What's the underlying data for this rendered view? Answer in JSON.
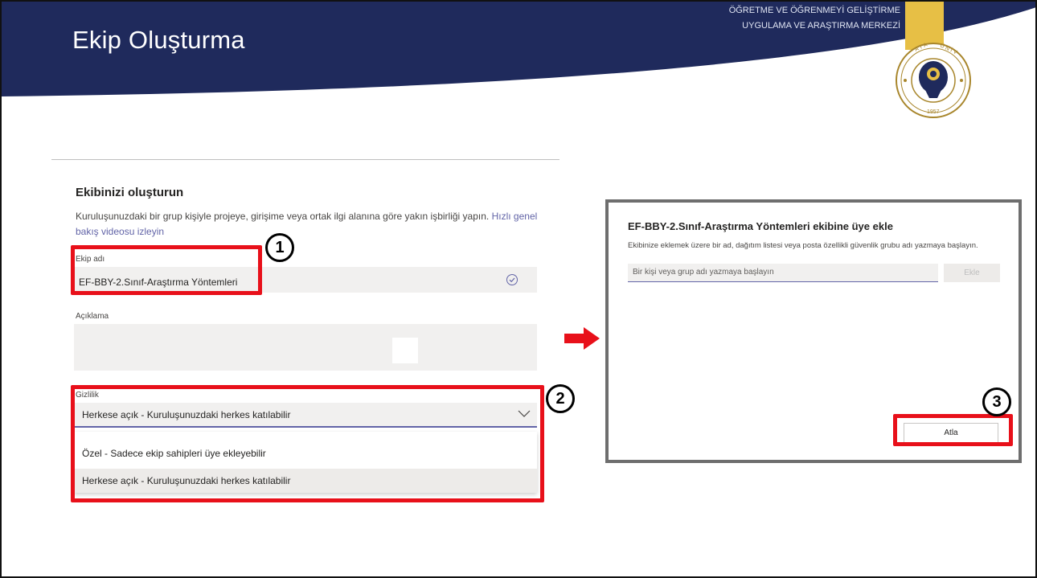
{
  "header": {
    "title": "Ekip Oluşturma",
    "center_line1": "ÖĞRETME VE ÖĞRENMEYİ GELİŞTİRME",
    "center_line2": "UYGULAMA VE ARAŞTIRMA MERKEZİ",
    "logo_icon": "university-seal-icon",
    "colors": {
      "header_bg": "#1f2a5c",
      "ribbon": "#e7bf45"
    }
  },
  "create_team_form": {
    "heading": "Ekibinizi oluşturun",
    "description": "Kuruluşunuzdaki bir grup kişiyle projeye, girişime veya ortak ilgi alanına göre yakın işbirliği yapın.",
    "video_link": "Hızlı genel bakış videosu izleyin",
    "team_name_label": "Ekip adı",
    "team_name_value": "EF-BBY-2.Sınıf-Araştırma Yöntemleri",
    "description_label": "Açıklama",
    "privacy_label": "Gizlilik",
    "privacy_selected": "Herkese açık - Kuruluşunuzdaki herkes katılabilir",
    "privacy_options": [
      "Özel - Sadece ekip sahipleri üye ekleyebilir",
      "Herkese açık - Kuruluşunuzdaki herkes katılabilir"
    ]
  },
  "add_members_dialog": {
    "title": "EF-BBY-2.Sınıf-Araştırma Yöntemleri ekibine üye ekle",
    "description": "Ekibinize eklemek üzere bir ad, dağıtım listesi veya posta özellikli güvenlik grubu adı yazmaya başlayın.",
    "input_placeholder": "Bir kişi veya grup adı yazmaya başlayın",
    "add_button": "Ekle",
    "skip_button": "Atla"
  },
  "annotations": {
    "step1": "1",
    "step2": "2",
    "step3": "3",
    "highlight_color": "#e8101a"
  }
}
